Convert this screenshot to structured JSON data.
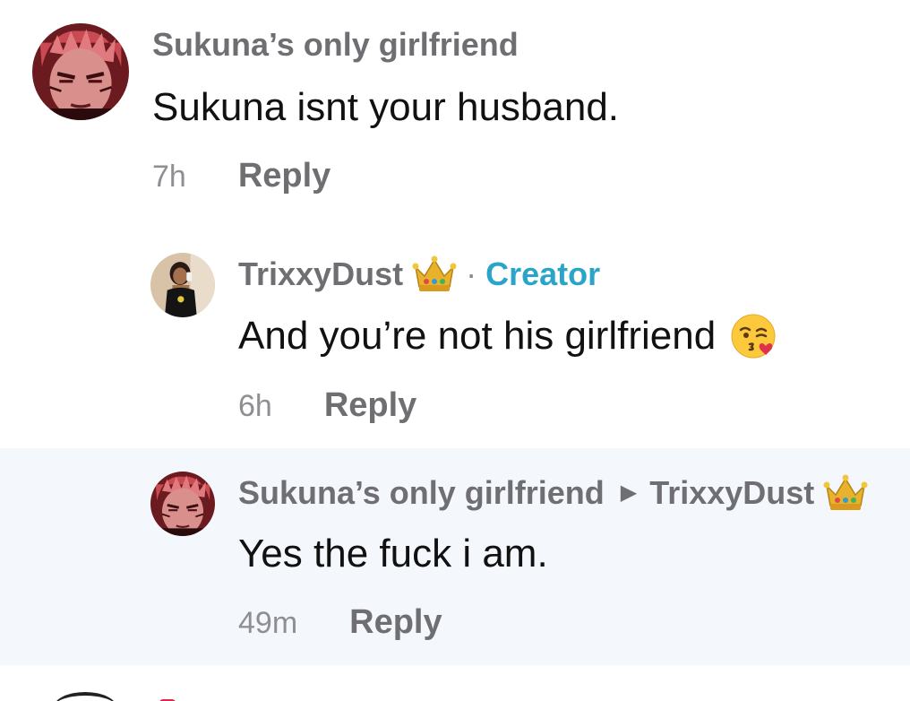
{
  "comments": {
    "top": {
      "author": "Sukuna’s only girlfriend",
      "text": "Sukuna isnt your husband.",
      "time": "7h",
      "reply_label": "Reply",
      "avatar_icon": "anime-character-avatar"
    },
    "reply1": {
      "author": "TrixxyDust",
      "badge_icon": "crown-icon",
      "separator": "·",
      "creator_label": "Creator",
      "text": "And you’re not his girlfriend",
      "emoji_icon": "kissing-heart-emoji",
      "time": "6h",
      "reply_label": "Reply",
      "avatar_icon": "user-photo-avatar"
    },
    "reply2": {
      "author": "Sukuna’s only girlfriend",
      "reply_to": "TrixxyDust",
      "badge_icon": "crown-icon",
      "text": "Yes the fuck i am.",
      "time": "49m",
      "reply_label": "Reply",
      "avatar_icon": "anime-character-avatar"
    }
  },
  "colors": {
    "author_gray": "#6f6f73",
    "creator_blue": "#2aa5c9",
    "highlight_bg": "#f4f7fb",
    "text_black": "#111111"
  }
}
